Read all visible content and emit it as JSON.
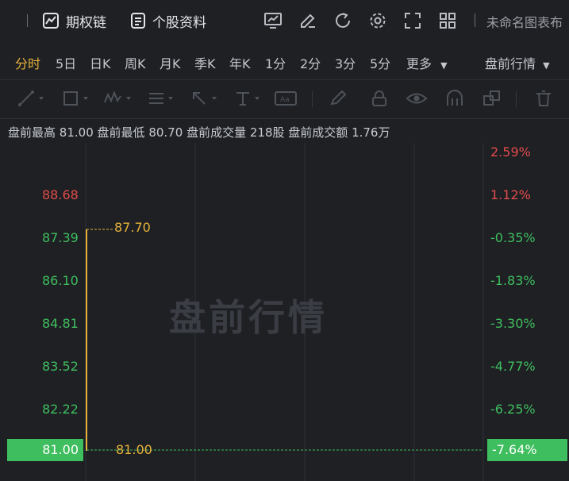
{
  "topbar": {
    "options_chain": "期权链",
    "stock_info": "个股资料",
    "untitled": "未命名图表布"
  },
  "periods": [
    "分时",
    "5日",
    "日K",
    "周K",
    "月K",
    "季K",
    "年K",
    "1分",
    "2分",
    "3分",
    "5分"
  ],
  "more_label": "更多",
  "session_label": "盘前行情",
  "stats": {
    "high_label": "盘前最高",
    "high": "81.00",
    "low_label": "盘前最低",
    "low": "80.70",
    "volume_label": "盘前成交量",
    "volume": "218股",
    "amount_label": "盘前成交额",
    "amount": "1.76万"
  },
  "watermark": "盘前行情",
  "axis": {
    "left_ticks": [
      "88.68",
      "87.39",
      "86.10",
      "84.81",
      "83.52",
      "82.22"
    ],
    "right_ticks": [
      "2.59%",
      "1.12%",
      "-0.35%",
      "-1.83%",
      "-3.30%",
      "-4.77%",
      "-6.25%"
    ],
    "current_price": "81.00",
    "current_pct": "-7.64%"
  },
  "points": {
    "high_label": "87.70",
    "last_label": "81.00"
  },
  "colors": {
    "up": "#e24b4b",
    "down": "#3fbe5f",
    "accent": "#e8b23a",
    "background": "#1e2024",
    "grid": "#2e3136"
  }
}
